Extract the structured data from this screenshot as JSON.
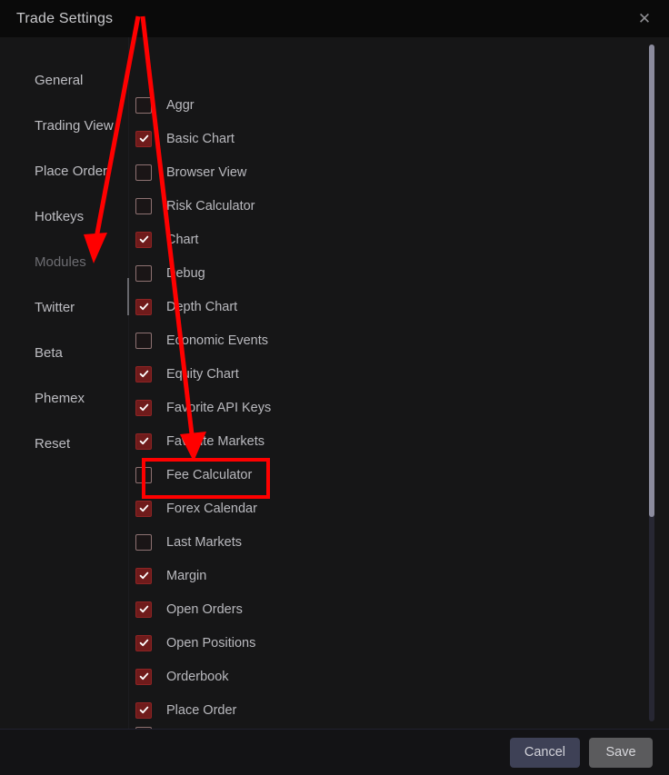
{
  "window": {
    "title": "Trade Settings",
    "close_icon": "close-icon",
    "close_glyph": "✕"
  },
  "sidebar": {
    "items": [
      {
        "label": "General",
        "active": false
      },
      {
        "label": "Trading View",
        "active": false
      },
      {
        "label": "Place Order",
        "active": false
      },
      {
        "label": "Hotkeys",
        "active": false
      },
      {
        "label": "Modules",
        "active": true
      },
      {
        "label": "Twitter",
        "active": false
      },
      {
        "label": "Beta",
        "active": false
      },
      {
        "label": "Phemex",
        "active": false
      },
      {
        "label": "Reset",
        "active": false
      }
    ]
  },
  "modules": {
    "items": [
      {
        "label": "Aggr",
        "checked": false
      },
      {
        "label": "Basic Chart",
        "checked": true
      },
      {
        "label": "Browser View",
        "checked": false
      },
      {
        "label": "Risk Calculator",
        "checked": false
      },
      {
        "label": "Chart",
        "checked": true
      },
      {
        "label": "Debug",
        "checked": false
      },
      {
        "label": "Depth Chart",
        "checked": true
      },
      {
        "label": "Economic Events",
        "checked": false
      },
      {
        "label": "Equity Chart",
        "checked": true
      },
      {
        "label": "Favorite API Keys",
        "checked": true
      },
      {
        "label": "Favorite Markets",
        "checked": true
      },
      {
        "label": "Fee Calculator",
        "checked": false
      },
      {
        "label": "Forex Calendar",
        "checked": true
      },
      {
        "label": "Last Markets",
        "checked": false
      },
      {
        "label": "Margin",
        "checked": true
      },
      {
        "label": "Open Orders",
        "checked": true
      },
      {
        "label": "Open Positions",
        "checked": true
      },
      {
        "label": "Orderbook",
        "checked": true
      },
      {
        "label": "Place Order",
        "checked": true
      }
    ]
  },
  "footer": {
    "cancel_label": "Cancel",
    "save_label": "Save"
  },
  "annotations": {
    "highlight_target": "Forex Calendar",
    "highlight_color": "#ff0000",
    "arrow_1_target": "Modules",
    "arrow_2_target": "Forex Calendar"
  },
  "colors": {
    "window_bg": "#161617",
    "titlebar_bg": "#0a0a0a",
    "checkbox_checked": "#6f1b1b",
    "accent_annotation": "#ff0000",
    "cancel_button": "#3e4156",
    "save_button": "#5b5b5d",
    "scrollbar_thumb": "#8b8b9d"
  }
}
